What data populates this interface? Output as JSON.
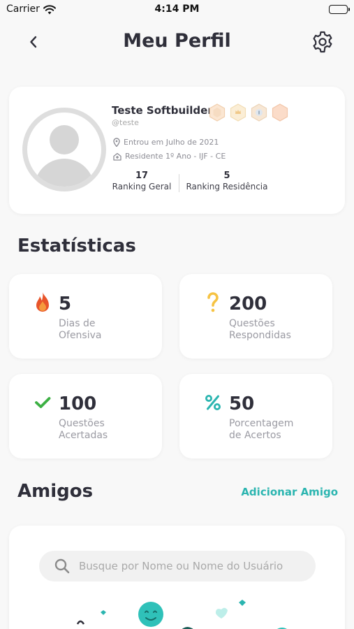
{
  "status_bar": {
    "carrier": "Carrier",
    "time": "4:14 PM"
  },
  "header": {
    "title": "Meu Perfil"
  },
  "profile": {
    "name": "Teste Softbuilder",
    "username": "@teste",
    "joined": "Entrou em Julho de 2021",
    "residence": "Residente 1º Ano - IJF - CE",
    "ranking_geral_value": "17",
    "ranking_geral_label": "Ranking Geral",
    "ranking_residencia_value": "5",
    "ranking_residencia_label": "Ranking Residência",
    "badges": [
      "badge-hexagon-icon",
      "badge-crown-icon",
      "badge-info-icon",
      "badge-hexagon-icon"
    ]
  },
  "stats": {
    "title": "Estatísticas",
    "items": [
      {
        "icon": "fire-icon",
        "value": "5",
        "label_line1": "Dias de",
        "label_line2": "Ofensiva",
        "color": "#e8542a"
      },
      {
        "icon": "question-icon",
        "value": "200",
        "label_line1": "Questões",
        "label_line2": "Respondidas",
        "color": "#f6c343"
      },
      {
        "icon": "check-icon",
        "value": "100",
        "label_line1": "Questões",
        "label_line2": "Acertadas",
        "color": "#3cb043"
      },
      {
        "icon": "percent-icon",
        "value": "50",
        "label_line1": "Porcentagem",
        "label_line2": "de Acertos",
        "color": "#2bb5b0"
      }
    ]
  },
  "friends": {
    "title": "Amigos",
    "add_label": "Adicionar Amigo",
    "search_placeholder": "Busque por Nome ou Nome do Usuário"
  },
  "colors": {
    "accent": "#2bb5b0",
    "text": "#2f2f3a",
    "muted": "#9b9ba3"
  }
}
